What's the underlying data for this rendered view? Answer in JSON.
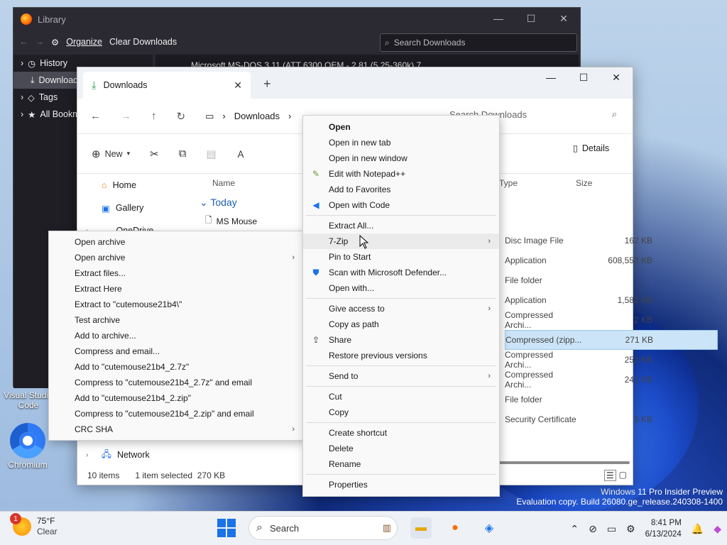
{
  "desktop": {
    "labels": [
      "Visual Studio Code",
      "Chromium"
    ],
    "watermark_line1": "Windows 11 Pro Insider Preview",
    "watermark_line2": "Evaluation copy. Build 26080.ge_release.240308-1400"
  },
  "library": {
    "title": "Library",
    "organize": "Organize",
    "clear_downloads": "Clear Downloads",
    "search_placeholder": "Search Downloads",
    "sidebar": [
      "History",
      "Downloads",
      "Tags",
      "All Bookmarks"
    ],
    "list_first": "Microsoft MS-DOS 3.11 (ATT 6300 OEM - 2.81 (5.25-360k) 7"
  },
  "explorer": {
    "tab_title": "Downloads",
    "breadcrumb": "Downloads",
    "search_placeholder": "Search Downloads",
    "new_label": "New",
    "details_label": "Details",
    "nav": [
      "Home",
      "Gallery",
      "OneDrive",
      "Network"
    ],
    "col_name": "Name",
    "col_type": "Type",
    "col_size": "Size",
    "group_today": "Today",
    "first_file": "MS Mouse",
    "rows": [
      {
        "type": "Disc Image File",
        "size": "162 KB"
      },
      {
        "type": "Application",
        "size": "608,553 KB"
      },
      {
        "type": "File folder",
        "size": ""
      },
      {
        "type": "Application",
        "size": "1,582 KB"
      },
      {
        "type": "Compressed Archi...",
        "size": "2 KB"
      },
      {
        "type": "Compressed (zipp...",
        "size": "271 KB"
      },
      {
        "type": "Compressed Archi...",
        "size": "252 KB"
      },
      {
        "type": "Compressed Archi...",
        "size": "241 KB"
      },
      {
        "type": "File folder",
        "size": ""
      },
      {
        "type": "Security Certificate",
        "size": "3 KB"
      }
    ],
    "status_items": "10 items",
    "status_selected": "1 item selected",
    "status_size": "270 KB"
  },
  "context_menu": {
    "items": [
      {
        "label": "Open",
        "bold": true,
        "icon": ""
      },
      {
        "label": "Open in new tab",
        "icon": ""
      },
      {
        "label": "Open in new window",
        "icon": ""
      },
      {
        "label": "Edit with Notepad++",
        "icon": "notepadpp-icon"
      },
      {
        "label": "Add to Favorites",
        "icon": ""
      },
      {
        "label": "Open with Code",
        "icon": "vscode-icon"
      },
      {
        "sep": true
      },
      {
        "label": "Extract All...",
        "icon": ""
      },
      {
        "label": "7-Zip",
        "icon": "",
        "submenu": true,
        "highlight": true
      },
      {
        "label": "Pin to Start",
        "icon": ""
      },
      {
        "label": "Scan with Microsoft Defender...",
        "icon": "defender-icon"
      },
      {
        "label": "Open with...",
        "icon": ""
      },
      {
        "sep": true
      },
      {
        "label": "Give access to",
        "icon": "",
        "submenu": true
      },
      {
        "label": "Copy as path",
        "icon": ""
      },
      {
        "label": "Share",
        "icon": "share-icon"
      },
      {
        "label": "Restore previous versions",
        "icon": ""
      },
      {
        "sep": true
      },
      {
        "label": "Send to",
        "icon": "",
        "submenu": true
      },
      {
        "sep": true
      },
      {
        "label": "Cut",
        "icon": ""
      },
      {
        "label": "Copy",
        "icon": ""
      },
      {
        "sep": true
      },
      {
        "label": "Create shortcut",
        "icon": ""
      },
      {
        "label": "Delete",
        "icon": ""
      },
      {
        "label": "Rename",
        "icon": ""
      },
      {
        "sep": true
      },
      {
        "label": "Properties",
        "icon": ""
      }
    ]
  },
  "sevenzip_menu": {
    "items": [
      {
        "label": "Open archive"
      },
      {
        "label": "Open archive",
        "submenu": true
      },
      {
        "label": "Extract files..."
      },
      {
        "label": "Extract Here"
      },
      {
        "label": "Extract to \"cutemouse21b4\\\""
      },
      {
        "label": "Test archive"
      },
      {
        "label": "Add to archive..."
      },
      {
        "label": "Compress and email..."
      },
      {
        "label": "Add to \"cutemouse21b4_2.7z\""
      },
      {
        "label": "Compress to \"cutemouse21b4_2.7z\" and email"
      },
      {
        "label": "Add to \"cutemouse21b4_2.zip\""
      },
      {
        "label": "Compress to \"cutemouse21b4_2.zip\" and email"
      },
      {
        "label": "CRC SHA",
        "submenu": true
      }
    ]
  },
  "taskbar": {
    "temp": "75°F",
    "condition": "Clear",
    "weather_badge": "1",
    "search_label": "Search",
    "time": "8:41 PM",
    "date": "6/13/2024"
  },
  "colors": {
    "accent": "#1a73e8",
    "selection": "#cce4f7"
  }
}
